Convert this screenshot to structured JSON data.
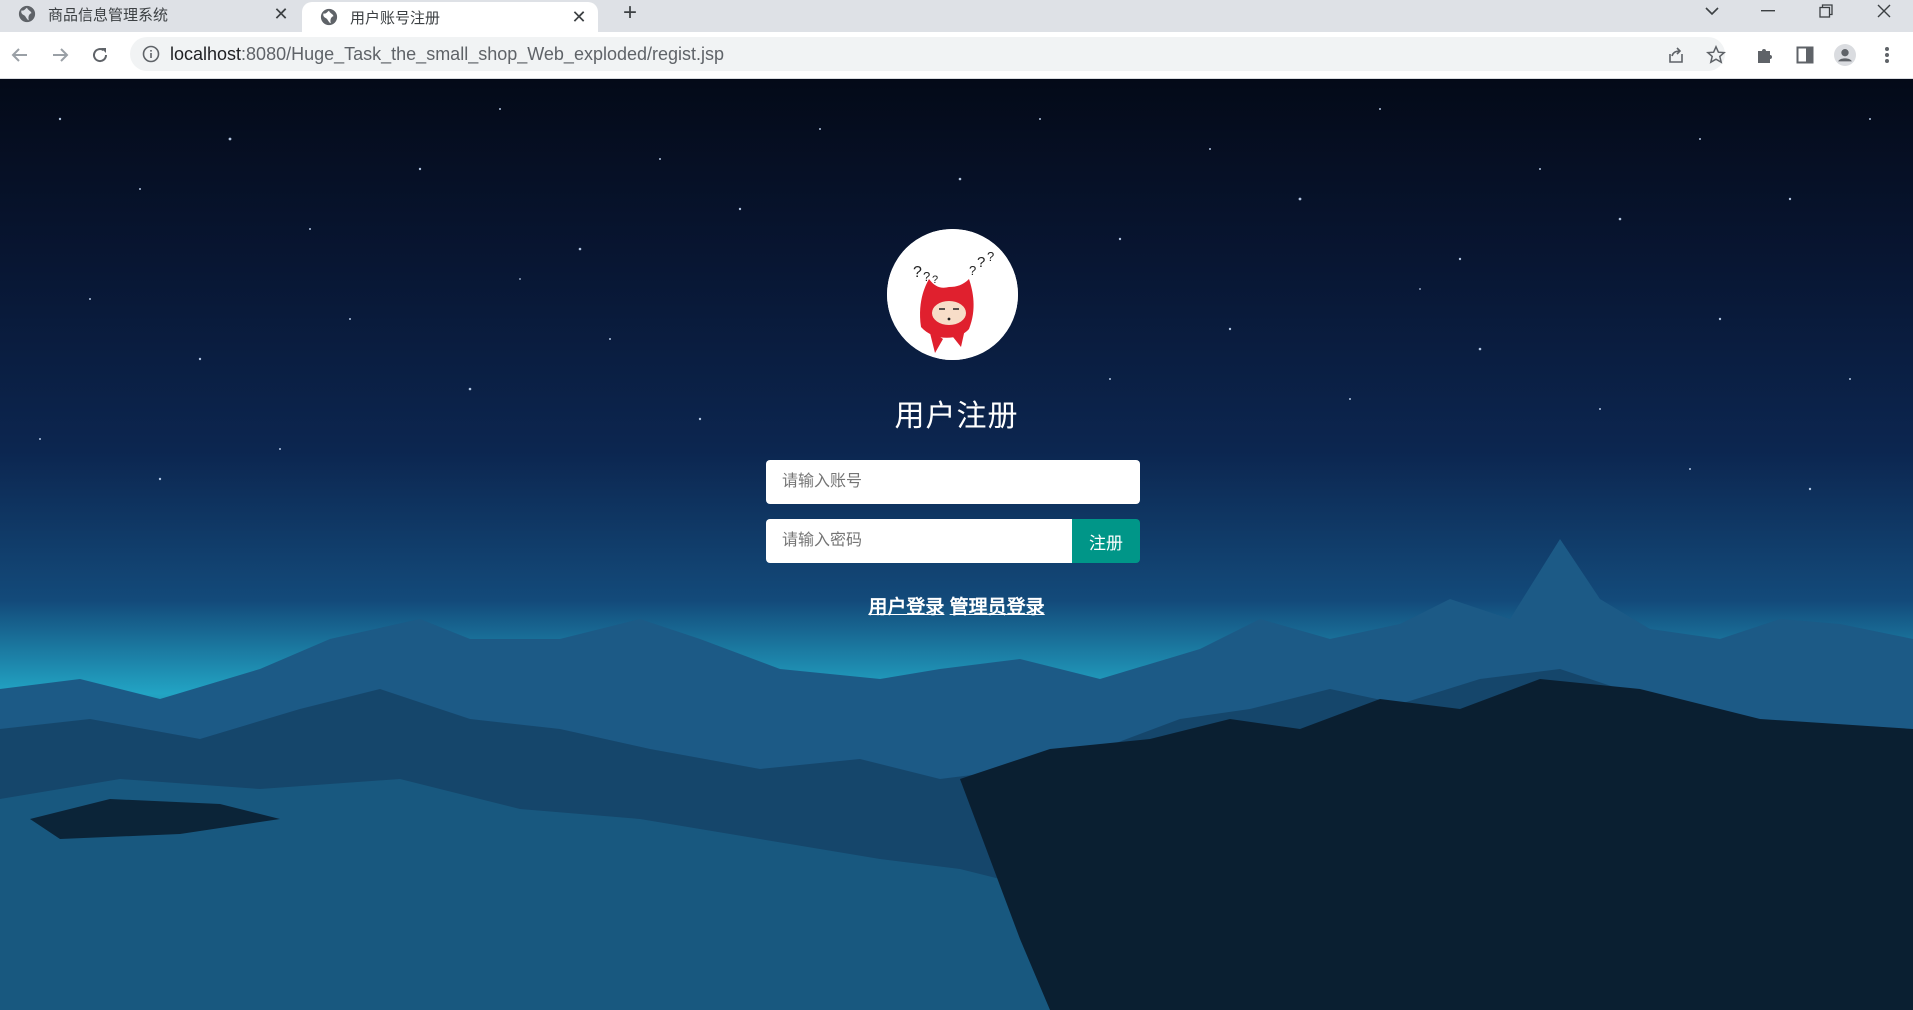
{
  "browser": {
    "tabs": [
      {
        "title": "商品信息管理系统",
        "active": false
      },
      {
        "title": "用户账号注册",
        "active": true
      }
    ],
    "url_host": "localhost",
    "url_rest": ":8080/Huge_Task_the_small_shop_Web_exploded/regist.jsp",
    "icons": {
      "back": "arrow-left",
      "forward": "arrow-right",
      "reload": "reload",
      "site_info": "info",
      "share": "share",
      "bookmark": "star",
      "extensions": "puzzle",
      "side_panel": "side-panel",
      "profile": "account-circle",
      "menu": "kebab",
      "tab_search": "chevron-down",
      "minimize": "minimize",
      "restore": "restore",
      "close": "close"
    }
  },
  "page": {
    "heading": "用户注册",
    "account_placeholder": "请输入账号",
    "password_placeholder": "请输入密码",
    "register_label": "注册",
    "user_login_label": "用户登录",
    "admin_login_label": "管理员登录",
    "colors": {
      "button": "#009688"
    }
  }
}
